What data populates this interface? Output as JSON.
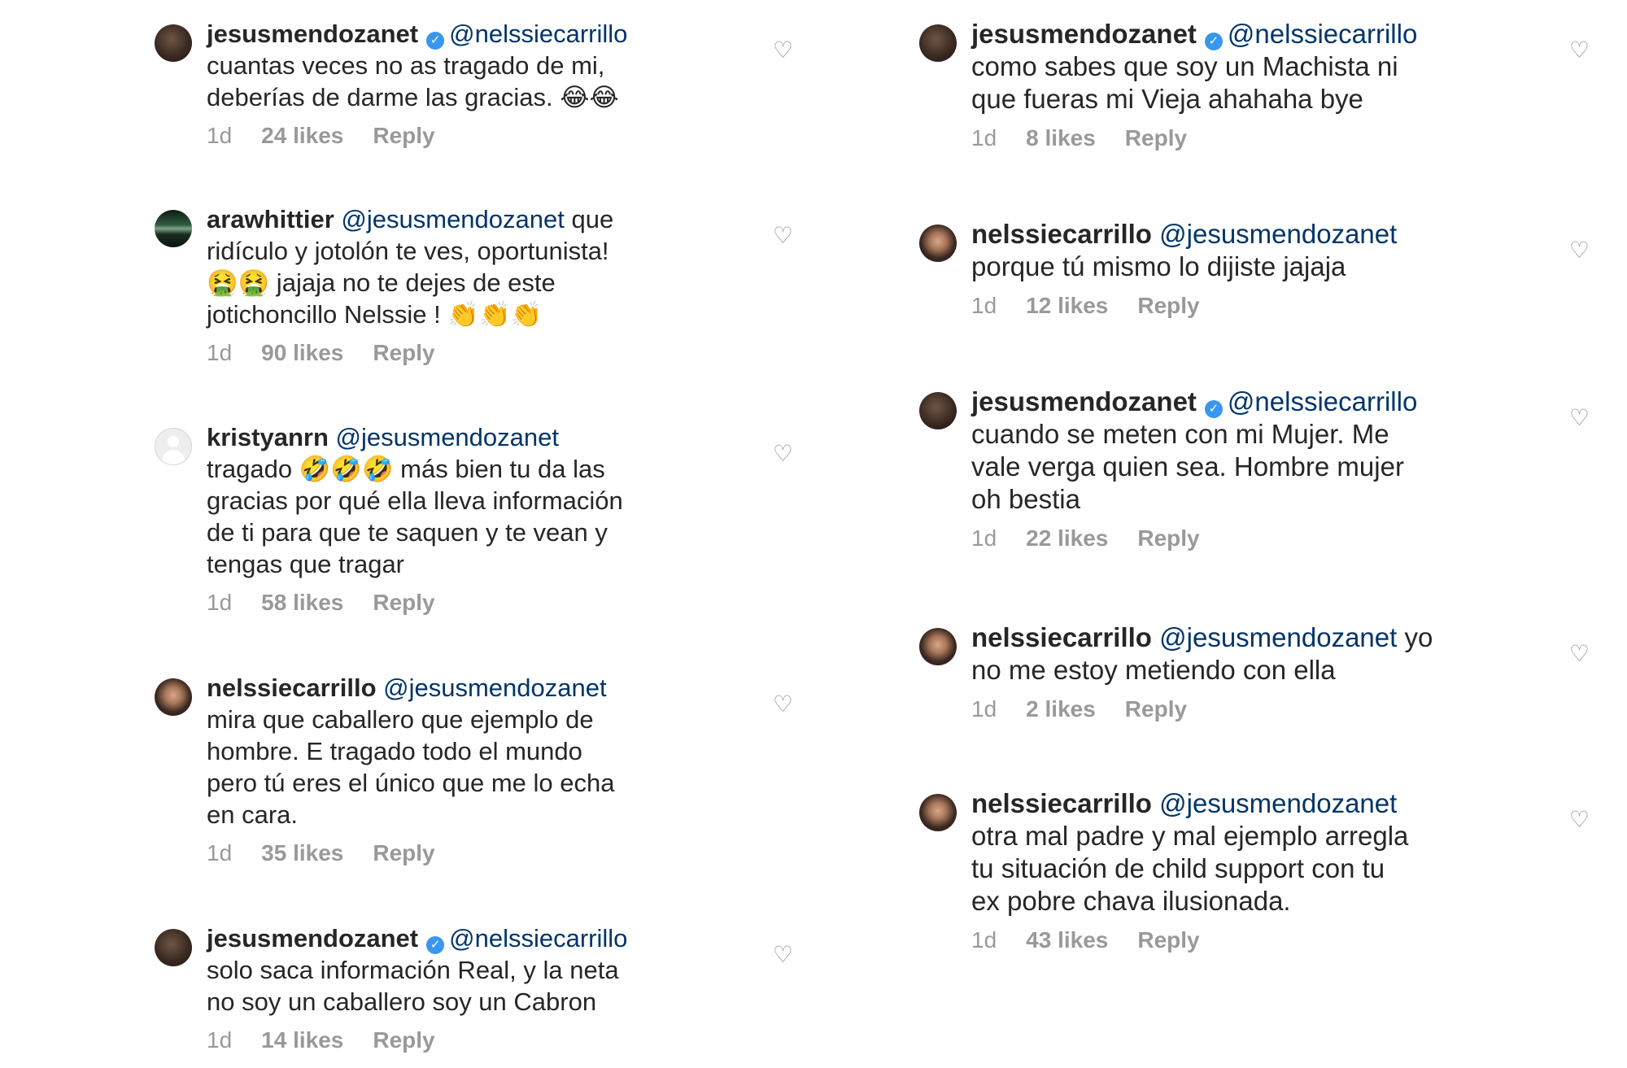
{
  "left_comments": [
    {
      "username": "jesusmendozanet",
      "verified": true,
      "mention": "@nelssiecarrillo",
      "text_lines": [
        "cuantas veces no as tragado de mi,",
        "deberías de darme las gracias. 😂😂"
      ],
      "time": "1d",
      "likes": "24 likes",
      "reply": "Reply"
    },
    {
      "username": "arawhittier",
      "verified": false,
      "mention": "@jesusmendozanet",
      "after_mention": " que",
      "text_lines": [
        "ridículo y jotolón te ves, oportunista!",
        "🤮🤮 jajaja no te dejes de este",
        "jotichoncillo Nelssie ! 👏👏👏"
      ],
      "time": "1d",
      "likes": "90 likes",
      "reply": "Reply"
    },
    {
      "username": "kristyanrn",
      "verified": false,
      "mention": "@jesusmendozanet",
      "text_lines": [
        "tragado 🤣🤣🤣 más bien tu da las",
        "gracias por qué ella lleva información",
        "de ti para que te saquen y te vean y",
        "tengas que tragar"
      ],
      "time": "1d",
      "likes": "58 likes",
      "reply": "Reply"
    },
    {
      "username": "nelssiecarrillo",
      "verified": false,
      "mention": "@jesusmendozanet",
      "text_lines": [
        "mira que caballero que ejemplo de",
        "hombre. E tragado todo el mundo",
        "pero tú eres el único que me lo echa",
        "en cara."
      ],
      "time": "1d",
      "likes": "35 likes",
      "reply": "Reply"
    },
    {
      "username": "jesusmendozanet",
      "verified": true,
      "mention": "@nelssiecarrillo",
      "text_lines": [
        "solo saca información Real, y la neta",
        "no soy un caballero soy un Cabron"
      ],
      "time": "1d",
      "likes": "14 likes",
      "reply": "Reply"
    }
  ],
  "right_comments": [
    {
      "username": "jesusmendozanet",
      "verified": true,
      "mention": "@nelssiecarrillo",
      "text_lines": [
        "como sabes que soy un Machista ni",
        "que fueras mi Vieja ahahaha bye"
      ],
      "time": "1d",
      "likes": "8 likes",
      "reply": "Reply"
    },
    {
      "username": "nelssiecarrillo",
      "verified": false,
      "mention": "@jesusmendozanet",
      "text_lines": [
        "porque tú mismo lo dijiste jajaja"
      ],
      "time": "1d",
      "likes": "12 likes",
      "reply": "Reply"
    },
    {
      "username": "jesusmendozanet",
      "verified": true,
      "mention": "@nelssiecarrillo",
      "text_lines": [
        "cuando se meten con mi Mujer. Me",
        "vale verga quien sea. Hombre mujer",
        "oh bestia"
      ],
      "time": "1d",
      "likes": "22 likes",
      "reply": "Reply"
    },
    {
      "username": "nelssiecarrillo",
      "verified": false,
      "mention": "@jesusmendozanet",
      "after_mention": " yo",
      "text_lines": [
        "no me estoy metiendo con ella"
      ],
      "time": "1d",
      "likes": "2 likes",
      "reply": "Reply"
    },
    {
      "username": "nelssiecarrillo",
      "verified": false,
      "mention": "@jesusmendozanet",
      "text_lines": [
        "otra mal padre y mal ejemplo arregla",
        "tu situación de child support con tu",
        "ex pobre chava ilusionada."
      ],
      "time": "1d",
      "likes": "43 likes",
      "reply": "Reply"
    }
  ],
  "icons": {
    "heart": "♡",
    "verified": "✓"
  },
  "colors": {
    "mention": "#003569",
    "verified": "#3897f0",
    "meta": "#999999",
    "text": "#262626"
  }
}
